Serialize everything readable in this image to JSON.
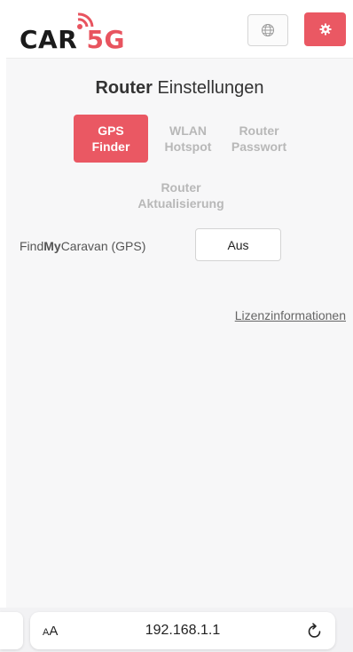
{
  "header": {
    "logo": {
      "text_prefix": "CAR",
      "text_suffix": "5G"
    },
    "language_icon": "globe-icon",
    "settings_icon": "gear-icon"
  },
  "title": {
    "bold": "Router",
    "rest": " Einstellungen"
  },
  "tabs": [
    {
      "line1": "GPS",
      "line2": "Finder",
      "active": true
    },
    {
      "line1": "WLAN",
      "line2": "Hotspot",
      "active": false
    },
    {
      "line1": "Router",
      "line2": "Passwort",
      "active": false
    },
    {
      "line1": "Router",
      "line2": "Aktualisierung",
      "active": false
    }
  ],
  "gps_setting": {
    "label_pre": "Find",
    "label_bold": "My",
    "label_post": "Caravan (GPS)",
    "toggle_value": "Aus"
  },
  "license_link": "Lizenzinformationen",
  "browser": {
    "text_size_label_small": "A",
    "text_size_label_large": "A",
    "url": "192.168.1.1",
    "reload_icon": "reload-icon"
  },
  "colors": {
    "accent": "#ea5863",
    "tab_inactive": "#b8b8b8",
    "page_bg": "#f7f7f8"
  }
}
